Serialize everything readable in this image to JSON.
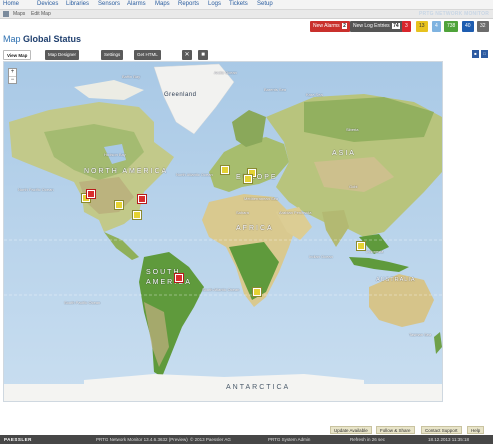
{
  "nav": {
    "items": [
      "Home",
      "Devices",
      "Libraries",
      "Sensors",
      "Alarms",
      "Maps",
      "Reports",
      "Logs",
      "Tickets",
      "Setup"
    ],
    "brand": "PRTG NETWORK MONITOR"
  },
  "breadcrumb": {
    "items": [
      "Maps",
      "Edit Map"
    ]
  },
  "status": {
    "new_alarms_label": "New Alarms",
    "new_alarms_count": "2",
    "new_log_label": "New Log Entries",
    "new_log_count": "74",
    "pills": [
      {
        "value": "3",
        "color": "#d9262c"
      },
      {
        "value": "13",
        "color": "#e7c21f"
      },
      {
        "value": "4",
        "color": "#7fb3e0"
      },
      {
        "value": "738",
        "color": "#4fa33a"
      },
      {
        "value": "40",
        "color": "#1e5db0"
      },
      {
        "value": "32",
        "color": "#6c6c6c"
      }
    ]
  },
  "page": {
    "title_prefix": "Map",
    "title_main": "Global Status"
  },
  "toolbar": {
    "view_map": "View Map",
    "map_designer": "Map Designer",
    "settings": "Settings",
    "get_html": "Get HTML",
    "delete_icon": "✕",
    "clone_icon": "■"
  },
  "map": {
    "zoom_in": "+",
    "zoom_out": "−",
    "labels": {
      "greenland": "Greenland",
      "north_america": "NORTH AMERICA",
      "south_america": "SOUTH AMERICA",
      "europe": "EUROPE",
      "asia": "ASIA",
      "africa": "AFRICA",
      "australia": "AUSTRALIA",
      "antarctica": "ANTARCTICA",
      "siberia": "Siberia",
      "sahara": "Sahara",
      "arabian_peninsula": "Arabian Peninsula",
      "gobi": "Gobi",
      "indonesia": "Indonesia",
      "baffin_bay": "Baffin Bay",
      "hudson_bay": "Hudson Bay",
      "north_atlantic": "North Atlantic Ocean",
      "south_atlantic": "South Atlantic Ocean",
      "north_pacific": "North Pacific Ocean",
      "south_pacific": "South Pacific Ocean",
      "indian_ocean": "Indian Ocean",
      "kara_sea": "Kara Sea",
      "barents_sea": "Barents Sea",
      "arctic_ocean": "Arctic Ocean",
      "mediterranean": "Mediterranean Sea",
      "tasman_sea": "Tasman Sea"
    }
  },
  "footer_actions": {
    "update": "Update Available",
    "follow": "Follow & Share",
    "contact": "Contact Support",
    "help": "Help"
  },
  "footer": {
    "logo": "PAESSLER",
    "version": "PRTG Network Monitor 13.4.6.3632 (Preview)",
    "copyright": "© 2013 Paessler AG",
    "user": "PRTG System Admin",
    "refresh": "Refresh in 26 sec",
    "datetime": "18.12.2013 11:35:18"
  }
}
